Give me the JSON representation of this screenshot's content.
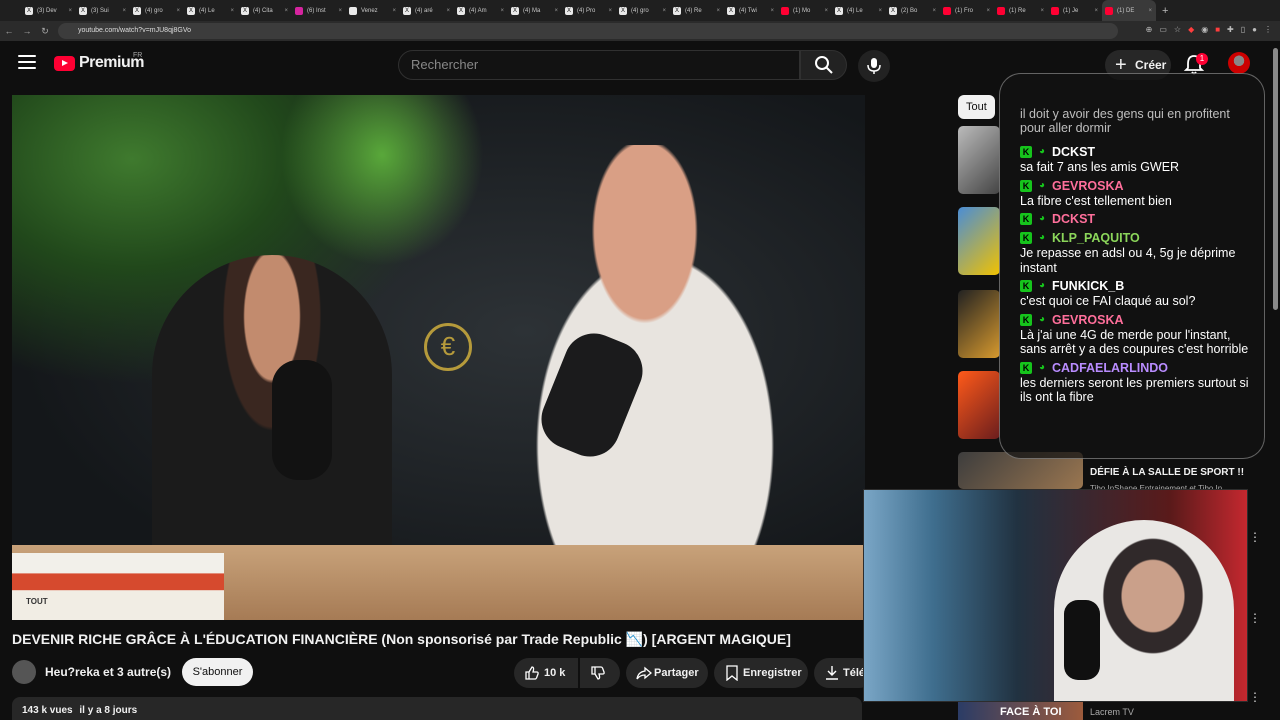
{
  "browser": {
    "tabs": [
      {
        "label": "(3) Dev",
        "icon": "x"
      },
      {
        "label": "(3) Sui",
        "icon": "x"
      },
      {
        "label": "(4) gro",
        "icon": "x"
      },
      {
        "label": "(4) Le",
        "icon": "x"
      },
      {
        "label": "(4) Cita",
        "icon": "x"
      },
      {
        "label": "(6) Inst",
        "icon": "instagram"
      },
      {
        "label": "Venez",
        "icon": "tiktok"
      },
      {
        "label": "(4) aré",
        "icon": "x"
      },
      {
        "label": "(4) Am",
        "icon": "x"
      },
      {
        "label": "(4) Ma",
        "icon": "x"
      },
      {
        "label": "(4) Pro",
        "icon": "x"
      },
      {
        "label": "(4) gro",
        "icon": "x"
      },
      {
        "label": "(4) Re",
        "icon": "x"
      },
      {
        "label": "(4) Twi",
        "icon": "x"
      },
      {
        "label": "(1) Mo",
        "icon": "youtube"
      },
      {
        "label": "(4) Le",
        "icon": "x"
      },
      {
        "label": "(2) Bo",
        "icon": "x"
      },
      {
        "label": "(1) Fro",
        "icon": "youtube"
      },
      {
        "label": "(1) Re",
        "icon": "youtube"
      },
      {
        "label": "(1) Je",
        "icon": "youtube"
      },
      {
        "label": "(1) DE",
        "icon": "youtube",
        "active": true
      }
    ],
    "url": "youtube.com/watch?v=mJU8qj8GVo"
  },
  "header": {
    "logo_text": "Premium",
    "country": "FR",
    "search_placeholder": "Rechercher",
    "create_label": "Créer",
    "notification_count": "1"
  },
  "video": {
    "title": "DEVENIR RICHE GRÂCE À L'ÉDUCATION FINANCIÈRE (Non sponsorisé par Trade Republic 📉) [ARGENT MAGIQUE]",
    "channel": "Heu?reka et 3 autre(s)",
    "subscribe_label": "S'abonner",
    "likes": "10 k",
    "share_label": "Partager",
    "save_label": "Enregistrer",
    "download_label": "Télécharger",
    "views": "143 k vues",
    "date": "il y a 8 jours",
    "book_label": "TOUT"
  },
  "sidebar": {
    "chips": [
      "Tout"
    ],
    "suggestions": [
      {
        "title": "DÉFIE À LA SALLE DE SPORT !!",
        "channel": "Tibo InShape Entrainement et Tibo In..."
      },
      {
        "overlay": "FACE À TOI",
        "channel": "Lacrem TV"
      }
    ]
  },
  "chat": {
    "partial": "il doit y avoir des gens qui en profitent pour aller dormir",
    "messages": [
      {
        "user": "DCKST",
        "text": "sa fait 7 ans les amis GWER",
        "color": "#ffffff"
      },
      {
        "user": "GEVROSKA",
        "text": "La fibre c'est tellement bien",
        "color": "#ff6f9b"
      },
      {
        "user": "DCKST",
        "text": "",
        "color": "#ff6f9b"
      },
      {
        "user": "KLP_PAQUITO",
        "text": "Je repasse en adsl ou 4, 5g je déprime instant",
        "color": "#8bd65a"
      },
      {
        "user": "FUNKICK_B",
        "text": "c'est quoi ce FAI claqué au sol?",
        "color": "#ffffff"
      },
      {
        "user": "GEVROSKA",
        "text": "Là j'ai une 4G de merde pour l'instant, sans arrêt y a des coupures c'est horrible",
        "color": "#ff6f9b"
      },
      {
        "user": "CADFAELARLINDO",
        "text": "les derniers seront les premiers surtout si ils ont la fibre",
        "color": "#b98cff"
      }
    ]
  }
}
